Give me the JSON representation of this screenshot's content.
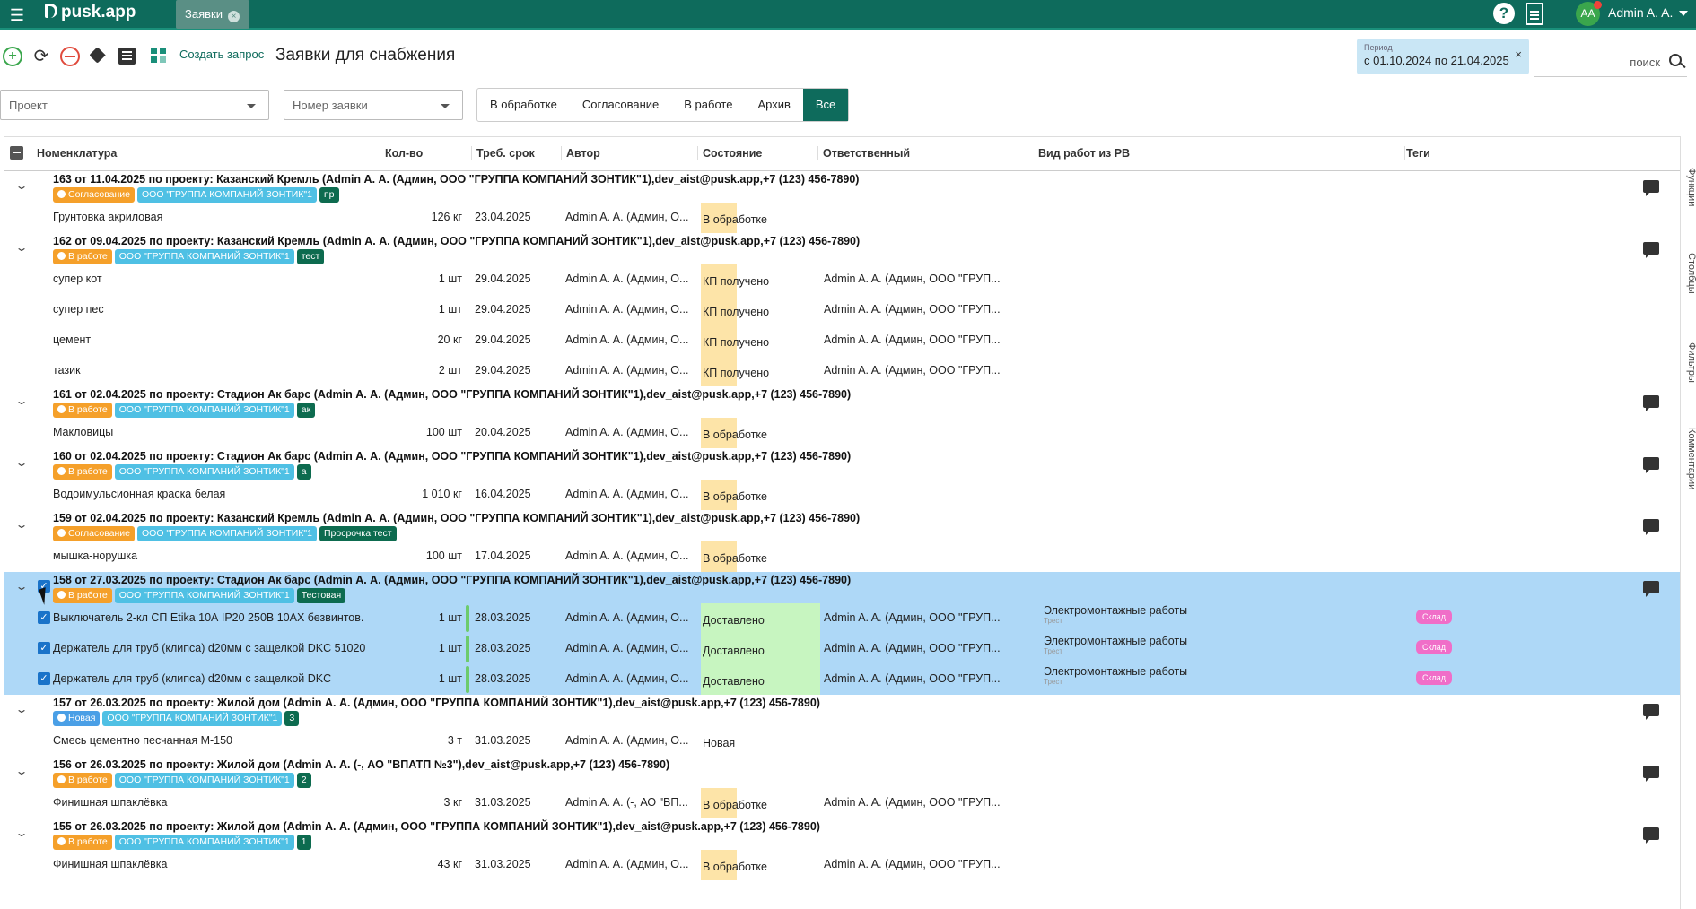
{
  "app": {
    "logo": "pusk.app",
    "tab_label": "Заявки",
    "user_initials": "AA",
    "user_name": "Admin A. A."
  },
  "toolbar": {
    "create_label": "Создать запрос",
    "title": "Заявки для снабжения"
  },
  "period": {
    "label": "Период",
    "value": "с 01.10.2024 по 21.04.2025",
    "clear": "×"
  },
  "search": {
    "label": "поиск"
  },
  "filters": {
    "project_placeholder": "Проект",
    "number_placeholder": "Номер заявки",
    "segments": [
      "В обработке",
      "Согласование",
      "В работе",
      "Архив",
      "Все"
    ],
    "active_segment": "Все"
  },
  "columns": [
    "Номенклатура",
    "Кол-во",
    "Треб. срок",
    "Автор",
    "Состояние",
    "Ответственный",
    "Вид работ из РВ",
    "Теги"
  ],
  "side_tabs": [
    "Функции",
    "Столбцы",
    "Фильтры",
    "Комментарии"
  ],
  "groups": [
    {
      "title": "163 от 11.04.2025 по проекту: Казанский Кремль (Admin А. А. (Админ, ООО \"ГРУППА КОМПАНИЙ ЗОНТИК\"1),dev_aist@pusk.app,+7 (123) 456-7890)",
      "status": "Согласование",
      "status_color": "orange",
      "org": "ООО \"ГРУППА КОМПАНИЙ ЗОНТИК\"1",
      "tag": "пр",
      "rows": [
        {
          "name": "Грунтовка акриловая",
          "qty": "126 кг",
          "date": "23.04.2025",
          "author": "Admin A. A. (Админ, О...",
          "state": "В обработке",
          "state_type": "yellow",
          "resp": ""
        }
      ]
    },
    {
      "title": "162 от 09.04.2025 по проекту: Казанский Кремль (Admin А. А. (Админ, ООО \"ГРУППА КОМПАНИЙ ЗОНТИК\"1),dev_aist@pusk.app,+7 (123) 456-7890)",
      "status": "В работе",
      "status_color": "orange",
      "org": "ООО \"ГРУППА КОМПАНИЙ ЗОНТИК\"1",
      "tag": "тест",
      "rows": [
        {
          "name": "супер кот",
          "qty": "1 шт",
          "date": "29.04.2025",
          "author": "Admin A. A. (Админ, О...",
          "state": "КП получено",
          "state_type": "kp",
          "resp": "Admin A. A. (Админ, ООО \"ГРУП..."
        },
        {
          "name": "супер пес",
          "qty": "1 шт",
          "date": "29.04.2025",
          "author": "Admin A. A. (Админ, О...",
          "state": "КП получено",
          "state_type": "kp",
          "resp": "Admin A. A. (Админ, ООО \"ГРУП..."
        },
        {
          "name": "цемент",
          "qty": "20 кг",
          "date": "29.04.2025",
          "author": "Admin A. A. (Админ, О...",
          "state": "КП получено",
          "state_type": "kp",
          "resp": "Admin A. A. (Админ, ООО \"ГРУП..."
        },
        {
          "name": "тазик",
          "qty": "2 шт",
          "date": "29.04.2025",
          "author": "Admin A. A. (Админ, О...",
          "state": "КП получено",
          "state_type": "kp",
          "resp": "Admin A. A. (Админ, ООО \"ГРУП..."
        }
      ]
    },
    {
      "title": "161 от 02.04.2025 по проекту: Стадион Ак барс (Admin А. А. (Админ, ООО \"ГРУППА КОМПАНИЙ ЗОНТИК\"1),dev_aist@pusk.app,+7 (123) 456-7890)",
      "status": "В работе",
      "status_color": "orange",
      "org": "ООО \"ГРУППА КОМПАНИЙ ЗОНТИК\"1",
      "tag": "ак",
      "rows": [
        {
          "name": "Макловицы",
          "qty": "100 шт",
          "date": "20.04.2025",
          "author": "Admin A. A. (Админ, О...",
          "state": "В обработке",
          "state_type": "yellow",
          "resp": ""
        }
      ]
    },
    {
      "title": "160 от 02.04.2025 по проекту: Стадион Ак барс (Admin А. А. (Админ, ООО \"ГРУППА КОМПАНИЙ ЗОНТИК\"1),dev_aist@pusk.app,+7 (123) 456-7890)",
      "status": "В работе",
      "status_color": "orange",
      "org": "ООО \"ГРУППА КОМПАНИЙ ЗОНТИК\"1",
      "tag": "а",
      "rows": [
        {
          "name": "Водоимульсионная краска белая",
          "qty": "1 010 кг",
          "date": "16.04.2025",
          "author": "Admin A. A. (Админ, О...",
          "state": "В обработке",
          "state_type": "yellow",
          "resp": ""
        }
      ]
    },
    {
      "title": "159 от 02.04.2025 по проекту: Казанский Кремль (Admin А. А. (Админ, ООО \"ГРУППА КОМПАНИЙ ЗОНТИК\"1),dev_aist@pusk.app,+7 (123) 456-7890)",
      "status": "Согласование",
      "status_color": "orange",
      "org": "ООО \"ГРУППА КОМПАНИЙ ЗОНТИК\"1",
      "tag": "Просрочка тест",
      "rows": [
        {
          "name": "мышка-норушка",
          "qty": "100 шт",
          "date": "17.04.2025",
          "author": "Admin A. A. (Админ, О...",
          "state": "В обработке",
          "state_type": "yellow",
          "resp": ""
        }
      ]
    },
    {
      "title": "158 от 27.03.2025 по проекту: Стадион Ак барс (Admin А. А. (Админ, ООО \"ГРУППА КОМПАНИЙ ЗОНТИК\"1),dev_aist@pusk.app,+7 (123) 456-7890)",
      "status": "В работе",
      "status_color": "orange",
      "org": "ООО \"ГРУППА КОМПАНИЙ ЗОНТИК\"1",
      "tag": "Тестовая",
      "selected": true,
      "rows": [
        {
          "name": "Выключатель 2-кл СП Etika 10А IP20 250В 10AX безвинтов.",
          "qty": "1 шт",
          "date": "28.03.2025",
          "author": "Admin A. A. (Админ, О...",
          "state": "Доставлено",
          "state_type": "green",
          "resp": "Admin A. A. (Админ, ООО \"ГРУП...",
          "work": "Электромонтажные работы",
          "work_sub": "Трест",
          "tag": "Склад"
        },
        {
          "name": "Держатель для труб (клипса) d20мм с защелкой DKC 51020",
          "qty": "1 шт",
          "date": "28.03.2025",
          "author": "Admin A. A. (Админ, О...",
          "state": "Доставлено",
          "state_type": "green",
          "resp": "Admin A. A. (Админ, ООО \"ГРУП...",
          "work": "Электромонтажные работы",
          "work_sub": "Трест",
          "tag": "Склад"
        },
        {
          "name": "Держатель для труб (клипса) d20мм с защелкой DKC",
          "qty": "1 шт",
          "date": "28.03.2025",
          "author": "Admin A. A. (Админ, О...",
          "state": "Доставлено",
          "state_type": "green",
          "resp": "Admin A. A. (Админ, ООО \"ГРУП...",
          "work": "Электромонтажные работы",
          "work_sub": "Трест",
          "tag": "Склад"
        }
      ]
    },
    {
      "title": "157 от 26.03.2025 по проекту: Жилой дом (Admin А. А. (Админ, ООО \"ГРУППА КОМПАНИЙ ЗОНТИК\"1),dev_aist@pusk.app,+7 (123) 456-7890)",
      "status": "Новая",
      "status_color": "new",
      "org": "ООО \"ГРУППА КОМПАНИЙ ЗОНТИК\"1",
      "tag": "3",
      "rows": [
        {
          "name": "Смесь цементно песчанная М-150",
          "qty": "3 т",
          "date": "31.03.2025",
          "author": "Admin A. A. (Админ, О...",
          "state": "Новая",
          "state_type": "plain",
          "resp": ""
        }
      ]
    },
    {
      "title": "156 от 26.03.2025 по проекту: Жилой дом (Admin А. А. (-, АО \"ВПАТП №3\"),dev_aist@pusk.app,+7 (123) 456-7890)",
      "status": "В работе",
      "status_color": "orange",
      "org": "ООО \"ГРУППА КОМПАНИЙ ЗОНТИК\"1",
      "tag": "2",
      "rows": [
        {
          "name": "Финишная шпаклёвка",
          "qty": "3 кг",
          "date": "31.03.2025",
          "author": "Admin A. A. (-, АО \"ВП...",
          "state": "В обработке",
          "state_type": "yellow",
          "resp": "Admin A. A. (Админ, ООО \"ГРУП..."
        }
      ]
    },
    {
      "title": "155 от 26.03.2025 по проекту: Жилой дом (Admin А. А. (Админ, ООО \"ГРУППА КОМПАНИЙ ЗОНТИК\"1),dev_aist@pusk.app,+7 (123) 456-7890)",
      "status": "В работе",
      "status_color": "orange",
      "org": "ООО \"ГРУППА КОМПАНИЙ ЗОНТИК\"1",
      "tag": "1",
      "rows": [
        {
          "name": "Финишная шпаклёвка",
          "qty": "43 кг",
          "date": "31.03.2025",
          "author": "Admin A. A. (Админ, О...",
          "state": "В обработке",
          "state_type": "yellow",
          "resp": "Admin A. A. (Админ, ООО \"ГРУП..."
        }
      ]
    }
  ]
}
